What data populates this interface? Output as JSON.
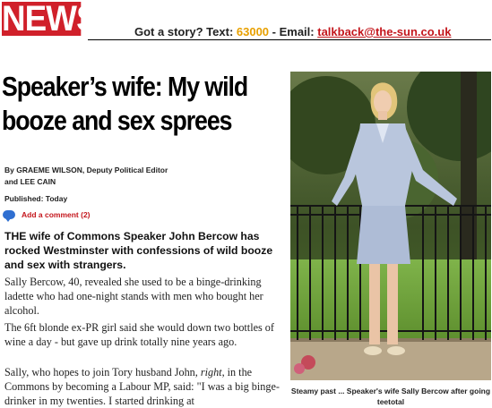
{
  "header": {
    "logo_text": "NEWS",
    "tagline_prefix": "Got a story? Text: ",
    "text_number": "63000",
    "email_prefix": " - Email: ",
    "email": "talkback@the-sun.co.uk"
  },
  "article": {
    "headline_line1": "Speaker’s wife: My wild",
    "headline_line2": "booze and sex sprees",
    "byline_line1": "By GRAEME WILSON, Deputy Political Editor",
    "byline_line2": "and LEE CAIN",
    "published": "Published: Today",
    "add_comment": "Add a comment (2)",
    "lede": "THE wife of Commons Speaker John Bercow has rocked Westminster with confessions of wild booze and sex with strangers.",
    "para1": "Sally Bercow, 40, revealed she used to be a binge-drinking ladette who had one-night stands with men who bought her alcohol.",
    "para2": "The 6ft blonde ex-PR girl said she would down two bottles of wine a day - but gave up drink totally nine years ago.",
    "para3_a": "Sally, who hopes to join Tory husband John, ",
    "para3_em": "right",
    "para3_b": ", in the Commons by becoming a Labour MP, said: \"I was a big binge-drinker in my twenties. I started drinking at"
  },
  "photo": {
    "caption": "Steamy past ... Speaker's wife Sally Bercow after going teetotal"
  },
  "colors": {
    "brand_red": "#d0202a",
    "link_red": "#c4161c",
    "orange": "#e8a000",
    "comment_blue": "#2f6fd1"
  }
}
